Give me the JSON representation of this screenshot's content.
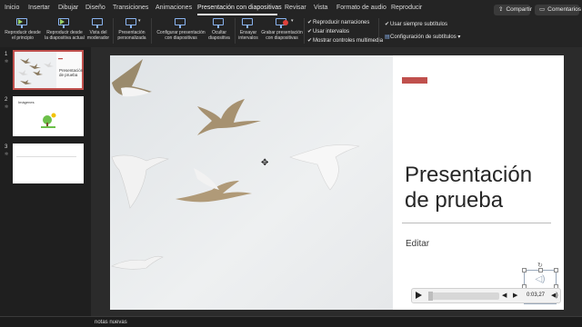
{
  "menu": {
    "tabs": [
      "Inicio",
      "Insertar",
      "Dibujar",
      "Diseño",
      "Transiciones",
      "Animaciones",
      "Presentación con diapositivas",
      "Revisar",
      "Vista",
      "Formato de audio",
      "Reproducir"
    ],
    "active_tab": "Presentación con diapositivas",
    "share_label": "Compartir",
    "comments_label": "Comentarios"
  },
  "ribbon": {
    "play_from_start": [
      "Reproducir desde",
      "el principio"
    ],
    "play_from_current": [
      "Reproducir desde",
      "la diapositiva actual"
    ],
    "presenter_view": [
      "Vista del",
      "moderador"
    ],
    "custom_show": [
      "Presentación",
      "personalizada"
    ],
    "setup_show": [
      "Configurar presentación",
      "con diapositivas"
    ],
    "hide_slide": [
      "Ocultar",
      "diapositiva"
    ],
    "rehearse": [
      "Ensayar",
      "intervalos"
    ],
    "record": [
      "Grabar presentación",
      "con diapositivas"
    ],
    "checks": [
      {
        "label": "Reproducir narraciones",
        "checked": true
      },
      {
        "label": "Usar intervalos",
        "checked": true
      },
      {
        "label": "Mostrar controles multimedia",
        "checked": true
      }
    ],
    "subtitles_check": {
      "label": "Usar siempre subtítulos",
      "checked": true
    },
    "subtitle_settings": "Configuración de subtítulos"
  },
  "thumbnails": [
    {
      "number": "1",
      "title": "Presentación de prueba",
      "selected": true
    },
    {
      "number": "2",
      "title": "Imágenes",
      "selected": false
    },
    {
      "number": "3",
      "title": "",
      "selected": false
    }
  ],
  "slide": {
    "title_line1": "Presentación",
    "title_line2": "de prueba",
    "subtitle": "Editar",
    "accent_color": "#c0504d"
  },
  "media": {
    "time": "0:03,27"
  },
  "notes": {
    "placeholder": "notas nuevas"
  }
}
